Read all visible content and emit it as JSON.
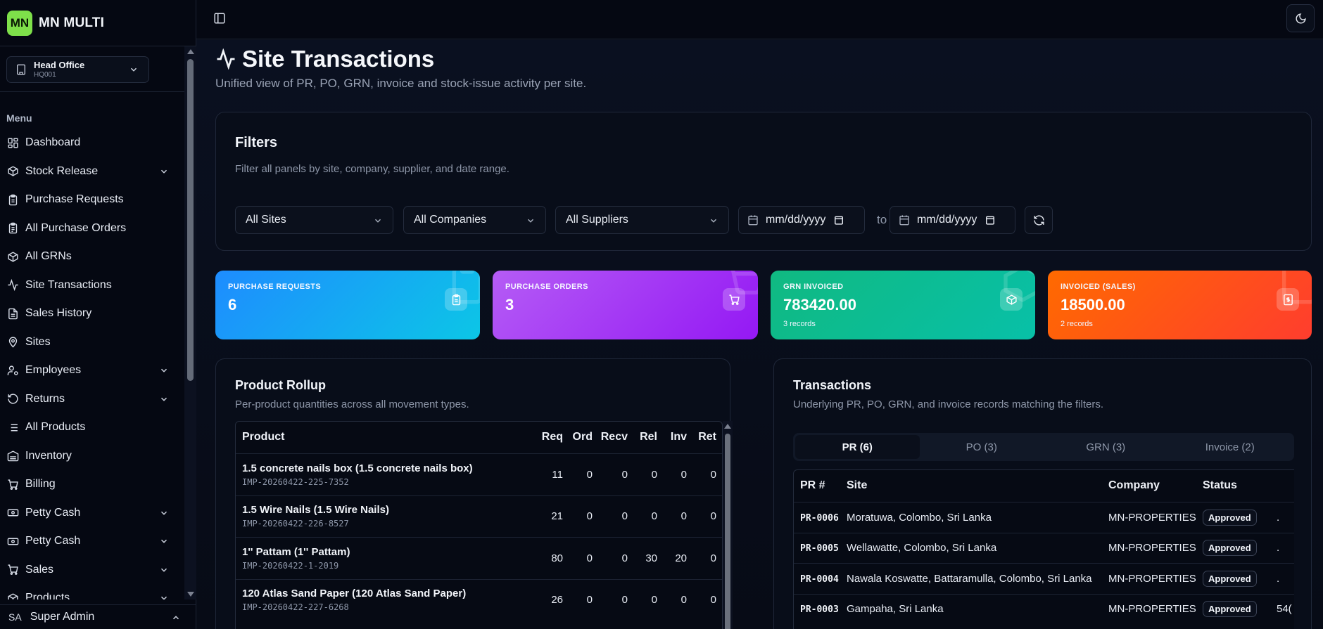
{
  "brand": {
    "logo_text": "MN",
    "name": "MN MULTI",
    "logo_color": "#7ee04a"
  },
  "office": {
    "name": "Head Office",
    "code": "HQ001"
  },
  "sidebar": {
    "menu_label": "Menu",
    "items": [
      {
        "label": "Dashboard",
        "icon": "dashboard-icon",
        "expandable": false
      },
      {
        "label": "Stock Release",
        "icon": "package-icon",
        "expandable": true
      },
      {
        "label": "Purchase Requests",
        "icon": "clipboard-icon",
        "expandable": false
      },
      {
        "label": "All Purchase Orders",
        "icon": "clipboard-list-icon",
        "expandable": false
      },
      {
        "label": "All GRNs",
        "icon": "box-icon",
        "expandable": false
      },
      {
        "label": "Site Transactions",
        "icon": "activity-icon",
        "expandable": false
      },
      {
        "label": "Sales History",
        "icon": "file-text-icon",
        "expandable": false
      },
      {
        "label": "Sites",
        "icon": "map-pin-icon",
        "expandable": false
      },
      {
        "label": "Employees",
        "icon": "user-cog-icon",
        "expandable": true
      },
      {
        "label": "Returns",
        "icon": "undo-icon",
        "expandable": true
      },
      {
        "label": "All Products",
        "icon": "list-icon",
        "expandable": false
      },
      {
        "label": "Inventory",
        "icon": "warehouse-icon",
        "expandable": false
      },
      {
        "label": "Billing",
        "icon": "cart-icon",
        "expandable": false
      },
      {
        "label": "Petty Cash",
        "icon": "cash-icon",
        "expandable": true
      },
      {
        "label": "Petty Cash",
        "icon": "cash-icon",
        "expandable": true
      },
      {
        "label": "Sales",
        "icon": "cart-icon",
        "expandable": true
      },
      {
        "label": "Products",
        "icon": "box-icon",
        "expandable": true
      }
    ],
    "user": {
      "initials": "SA",
      "name": "Super Admin"
    }
  },
  "page": {
    "title": "Site Transactions",
    "subtitle": "Unified view of PR, PO, GRN, invoice and stock-issue activity per site."
  },
  "filters": {
    "title": "Filters",
    "subtitle": "Filter all panels by site, company, supplier, and date range.",
    "site": "All Sites",
    "company": "All Companies",
    "supplier": "All Suppliers",
    "date_from": "mm/dd/yyyy",
    "to_label": "to",
    "date_to": "mm/dd/yyyy"
  },
  "stats": [
    {
      "label": "PURCHASE REQUESTS",
      "value": "6",
      "sub": "",
      "icon": "clipboard-icon",
      "color_from": "#1e8cff",
      "color_to": "#0cc6e6"
    },
    {
      "label": "PURCHASE ORDERS",
      "value": "3",
      "sub": "",
      "icon": "cart-icon",
      "color_from": "#b55cf5",
      "color_to": "#9418f4"
    },
    {
      "label": "GRN INVOICED",
      "value": "783420.00",
      "sub": "3 records",
      "icon": "box-icon",
      "color_from": "#10b981",
      "color_to": "#08c0a8"
    },
    {
      "label": "INVOICED (SALES)",
      "value": "18500.00",
      "sub": "2 records",
      "icon": "receipt-icon",
      "color_from": "#ff6a00",
      "color_to": "#ff3d2e"
    }
  ],
  "rollup": {
    "title": "Product Rollup",
    "subtitle": "Per-product quantities across all movement types.",
    "columns": [
      "Product",
      "Req",
      "Ord",
      "Recv",
      "Rel",
      "Inv",
      "Ret"
    ],
    "rows": [
      {
        "name": "1.5 concrete nails box (1.5 concrete nails box)",
        "code": "IMP-20260422-225-7352",
        "req": "11",
        "ord": "0",
        "recv": "0",
        "rel": "0",
        "inv": "0",
        "ret": "0"
      },
      {
        "name": "1.5 Wire Nails (1.5 Wire Nails)",
        "code": "IMP-20260422-226-8527",
        "req": "21",
        "ord": "0",
        "recv": "0",
        "rel": "0",
        "inv": "0",
        "ret": "0"
      },
      {
        "name": "1'' Pattam (1'' Pattam)",
        "code": "IMP-20260422-1-2019",
        "req": "80",
        "ord": "0",
        "recv": "0",
        "rel": "30",
        "inv": "20",
        "ret": "0"
      },
      {
        "name": "120 Atlas Sand Paper (120 Atlas Sand Paper)",
        "code": "IMP-20260422-227-6268",
        "req": "26",
        "ord": "0",
        "recv": "0",
        "rel": "0",
        "inv": "0",
        "ret": "0"
      }
    ]
  },
  "transactions": {
    "title": "Transactions",
    "subtitle": "Underlying PR, PO, GRN, and invoice records matching the filters.",
    "tabs": [
      "PR (6)",
      "PO (3)",
      "GRN (3)",
      "Invoice (2)"
    ],
    "active_tab": 0,
    "columns": [
      "PR #",
      "Site",
      "Company",
      "Status"
    ],
    "rows": [
      {
        "pr": "PR-0006",
        "site": "Moratuwa, Colombo, Sri Lanka",
        "company": "MN-PROPERTIES",
        "status": "Approved",
        "extra": "."
      },
      {
        "pr": "PR-0005",
        "site": "Wellawatte, Colombo, Sri Lanka",
        "company": "MN-PROPERTIES",
        "status": "Approved",
        "extra": "."
      },
      {
        "pr": "PR-0004",
        "site": "Nawala Koswatte, Battaramulla, Colombo, Sri Lanka",
        "company": "MN-PROPERTIES",
        "status": "Approved",
        "extra": "."
      },
      {
        "pr": "PR-0003",
        "site": "Gampaha, Sri Lanka",
        "company": "MN-PROPERTIES",
        "status": "Approved",
        "extra": "54("
      }
    ]
  }
}
